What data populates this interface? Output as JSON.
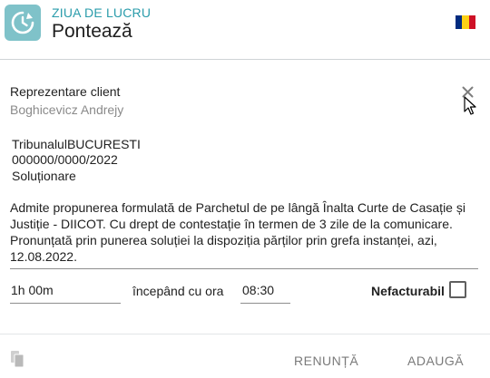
{
  "header": {
    "subtitle": "ZIUA DE LUCRU",
    "title": "Pontează",
    "logo_icon": "clock-refresh-icon",
    "flag_colors": [
      "#002b7f",
      "#fcd116",
      "#ce1126"
    ]
  },
  "client": {
    "label": "Reprezentare client",
    "name": "Boghicevicz Andrejy",
    "close_icon": "close-icon"
  },
  "case": {
    "court": "TribunalulBUCURESTI",
    "number": "000000/0000/2022",
    "stage": "Soluționare",
    "solution": "Admite propunerea formulată de Parchetul de pe lângă Înalta Curte de Casație și Justiție - DIICOT. Cu drept de contestație în termen de 3 zile de la comunicare. Pronunțată prin punerea soluției la dispoziția părților prin grefa instanței, azi, 12.08.2022."
  },
  "time_entry": {
    "duration": "1h 00m",
    "from_label": "începând cu ora",
    "start_time": "08:30",
    "nonbillable_label": "Nefacturabil",
    "nonbillable_checked": false
  },
  "footer": {
    "copy_icon": "copy-icon",
    "cancel_label": "RENUNȚĂ",
    "add_label": "ADAUGĂ"
  }
}
